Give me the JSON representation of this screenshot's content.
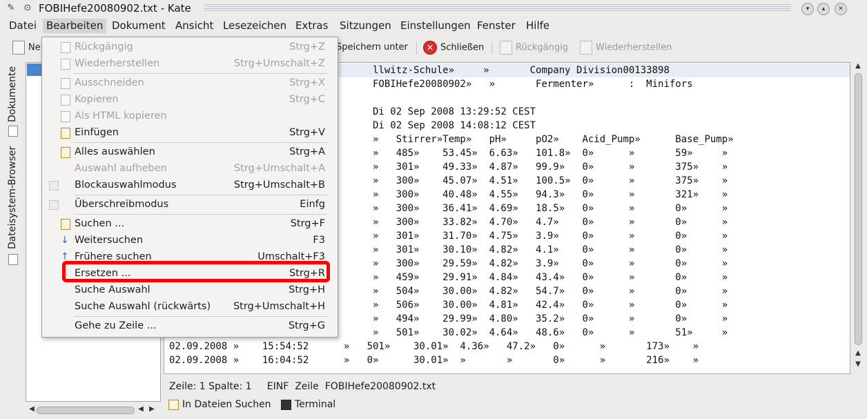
{
  "window": {
    "title": "FOBIHefe20080902.txt - Kate"
  },
  "menubar": {
    "items": [
      "Datei",
      "Bearbeiten",
      "Dokument",
      "Ansicht",
      "Lesezeichen",
      "Extras",
      "Sitzungen",
      "Einstellungen",
      "Fenster",
      "Hilfe"
    ]
  },
  "toolbar": {
    "new": "Ne",
    "save_as": "Speichern unter",
    "close": "Schließen",
    "undo": "Rückgängig",
    "redo": "Wiederherstellen"
  },
  "sidebar": {
    "tab_documents": "Dokumente",
    "tab_filesystem": "Dateisystem-Browser"
  },
  "editor": {
    "lines": [
      "                                   llwitz-Schule»     »       Company Division00133898",
      "                                   FOBIHefe20080902»   »       Fermenter»      :  Minifors",
      "",
      "                                   Di 02 Sep 2008 13:29:52 CEST",
      "                                   Di 02 Sep 2008 14:08:12 CEST",
      "                                   »   Stirrer»Temp»   pH»     pO2»    Acid_Pump»      Base_Pump»",
      "                                   »   485»    53.45»  6.63»   101.8»  0»      »       59»     »",
      "                                   »   301»    49.33»  4.87»   99.9»   0»      »       375»    »",
      "                                   »   300»    45.07»  4.51»   100.5»  0»      »       375»    »",
      "                                   »   300»    40.48»  4.55»   94.3»   0»      »       321»    »",
      "                                   »   300»    36.41»  4.69»   18.5»   0»      »       0»      »",
      "                                   »   300»    33.82»  4.70»   4.7»    0»      »       0»      »",
      "                                   »   301»    31.70»  4.75»   3.9»    0»      »       0»      »",
      "                                   »   301»    30.10»  4.82»   4.1»    0»      »       0»      »",
      "                                   »   300»    29.59»  4.82»   3.9»    0»      »       0»      »",
      "                                   »   459»    29.91»  4.84»   43.4»   0»      »       0»      »",
      "                                   »   504»    30.00»  4.82»   54.7»   0»      »       0»      »",
      "                                   »   506»    30.00»  4.81»   42.4»   0»      »       0»      »",
      "                                   »   494»    29.99»  4.80»   35.2»   0»      »       0»      »",
      "                                   »   501»    30.02»  4.64»   48.6»   0»      »       51»     »",
      "02.09.2008 »    15:54:52      »   501»    30.01»  4.36»   47.2»   0»      »       173»    »",
      "02.09.2008 »    16:04:52      »   0»      30.01»  »       »       0»      »       216»    »"
    ]
  },
  "status": {
    "text": "Zeile: 1 Spalte: 1     EINF  Zeile  FOBIHefe20080902.txt"
  },
  "bottom": {
    "search_files": "In Dateien Suchen",
    "terminal": "Terminal"
  },
  "edit_menu": {
    "items": [
      {
        "label": "Rückgängig",
        "shortcut": "Strg+Z"
      },
      {
        "label": "Wiederherstellen",
        "shortcut": "Strg+Umschalt+Z"
      },
      {
        "label": "Ausschneiden",
        "shortcut": "Strg+X"
      },
      {
        "label": "Kopieren",
        "shortcut": "Strg+C"
      },
      {
        "label": "Als HTML kopieren",
        "shortcut": ""
      },
      {
        "label": "Einfügen",
        "shortcut": "Strg+V"
      },
      {
        "label": "Alles auswählen",
        "shortcut": "Strg+A"
      },
      {
        "label": "Auswahl aufheben",
        "shortcut": "Strg+Umschalt+A"
      },
      {
        "label": "Blockauswahlmodus",
        "shortcut": "Strg+Umschalt+B"
      },
      {
        "label": "Überschreibmodus",
        "shortcut": "Einfg"
      },
      {
        "label": "Suchen ...",
        "shortcut": "Strg+F"
      },
      {
        "label": "Weitersuchen",
        "shortcut": "F3"
      },
      {
        "label": "Frühere suchen",
        "shortcut": "Umschalt+F3"
      },
      {
        "label": "Ersetzen ...",
        "shortcut": "Strg+R"
      },
      {
        "label": "Suche Auswahl",
        "shortcut": "Strg+H"
      },
      {
        "label": "Suche Auswahl (rückwärts)",
        "shortcut": "Strg+Umschalt+H"
      },
      {
        "label": "Gehe zu Zeile ...",
        "shortcut": "Strg+G"
      }
    ]
  }
}
